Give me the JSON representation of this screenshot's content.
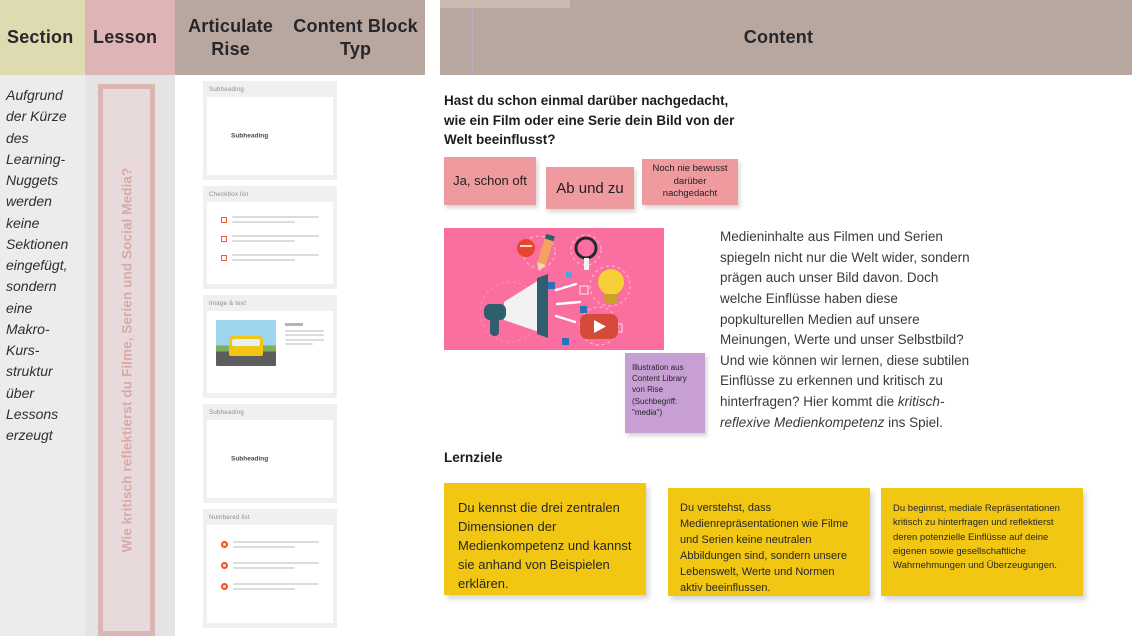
{
  "header": {
    "section": "Section",
    "lesson": "Lesson",
    "rise_line1": "Articulate Rise",
    "rise_line2": "Content Block Typ",
    "content": "Content"
  },
  "section_column": {
    "note": "Aufgrund der Kürze des Learning-Nuggets werden keine Sektionen eingefügt, sondern eine Makro-Kurs-struktur über Lessons erzeugt"
  },
  "lesson_column": {
    "vertical_label": "Wie kritisch reflektierst du Filme, Serien und Social Media?"
  },
  "rise_column": {
    "blocks": [
      {
        "label": "Subheading",
        "type": "subheading",
        "caption": "Subheading"
      },
      {
        "label": "Checkbox list",
        "type": "checkbox"
      },
      {
        "label": "Image & text",
        "type": "image-text"
      },
      {
        "label": "Subheading",
        "type": "subheading",
        "caption": "Subheading"
      },
      {
        "label": "Numbered list",
        "type": "numbered"
      }
    ]
  },
  "content": {
    "question": "Hast du schon einmal darüber nachgedacht, wie ein Film oder eine Serie dein Bild von der Welt beeinflusst?",
    "answers": [
      "Ja, schon oft",
      "Ab und zu",
      "Noch nie bewusst darüber nachgedacht"
    ],
    "illustration_note": "Illustration aus Content Library von Rise (Suchbegriff: \"media\")",
    "body_part1": "Medieninhalte aus Filmen und Serien spiegeln nicht nur die Welt wider, sondern prägen auch unser Bild davon. Doch welche Einflüsse haben diese popkulturellen Medien auf unsere Meinungen, Werte und unser Selbstbild? Und wie können wir lernen, diese subtilen Einflüsse zu erkennen und kritisch zu hinterfragen? Hier kommt die ",
    "body_emphasis": "kritisch-reflexive Medienkompetenz",
    "body_part2": " ins Spiel.",
    "objectives_title": "Lernziele",
    "objectives": [
      "Du kennst  die drei zentralen Dimensionen der Medienkompetenz und kannst sie anhand von Beispielen erklären.",
      "Du verstehst, dass Medienrepräsentationen wie Filme und Serien keine neutralen Abbildungen sind, sondern unsere Lebenswelt, Werte und Normen aktiv beeinflussen.",
      "Du beginnst, mediale Repräsentationen kritisch zu hinterfragen und reflektierst deren potenzielle Einflüsse auf deine eigenen sowie gesellschaftliche Wahrnehmungen und Überzeugungen."
    ]
  },
  "colors": {
    "header_section": "#dedbb0",
    "header_lesson": "#dfb4b4",
    "header_rise": "#b8a79e",
    "sticky_pink": "#ef9a9f",
    "sticky_yellow": "#f2c713",
    "sticky_purple": "#c79fd4",
    "illustration_bg": "#fb6fa0",
    "rise_accent": "#f05a28"
  }
}
